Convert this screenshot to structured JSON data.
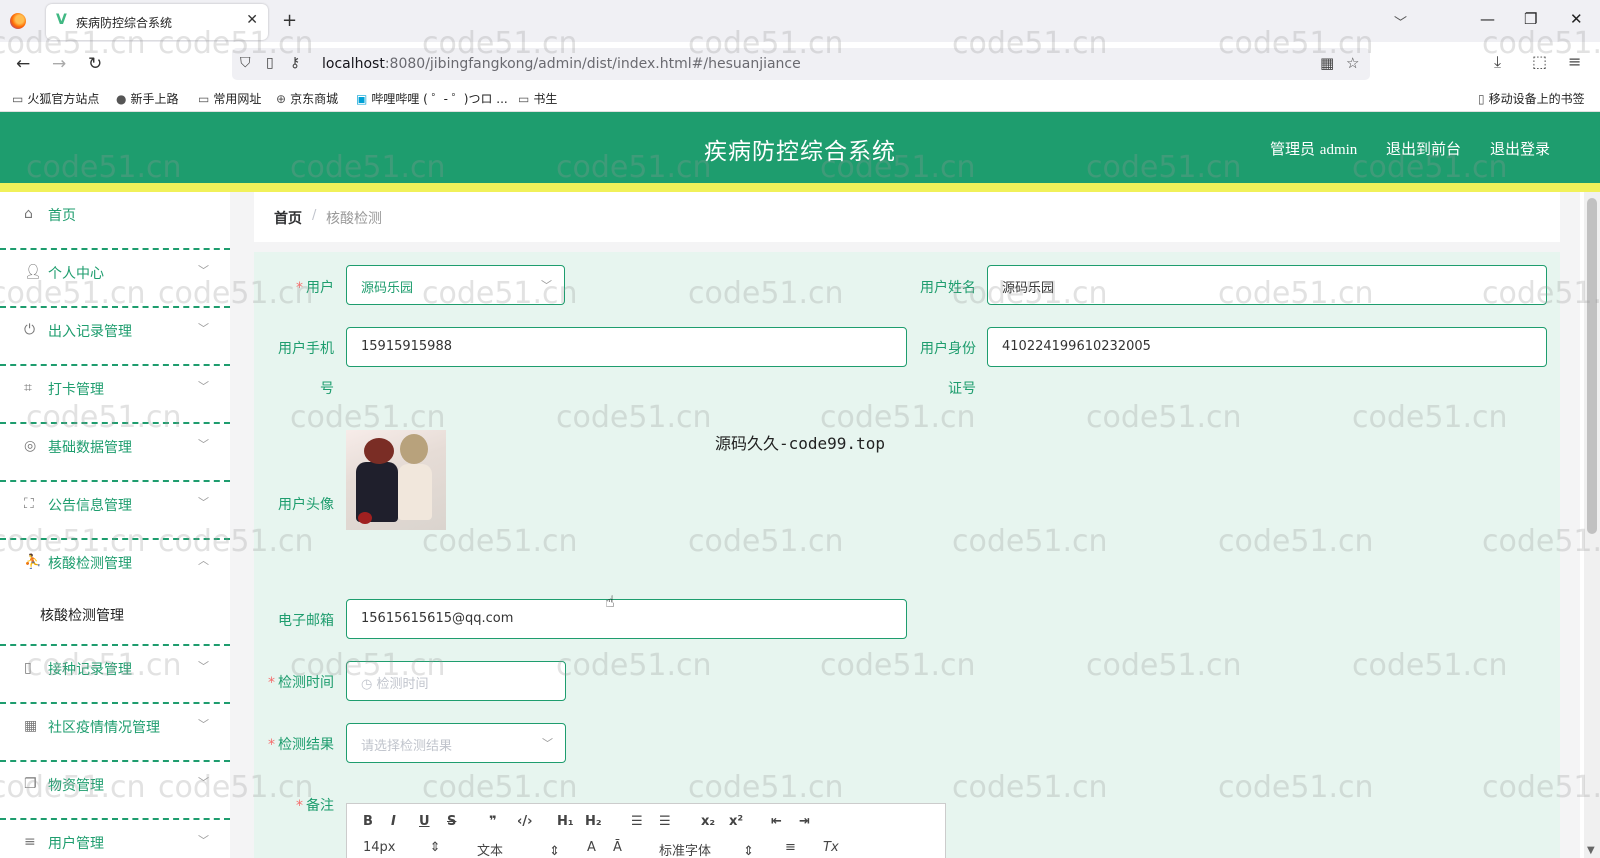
{
  "browser": {
    "tab_title": "疾病防控综合系统",
    "url_host": "localhost",
    "url_rest": ":8080/jibingfangkong/admin/dist/index.html#/hesuanjiance",
    "bookmarks": [
      "火狐官方站点",
      "新手上路",
      "常用网址",
      "京东商城",
      "哔哩哔哩 ( ゜- ゜)つロ ...",
      "书生"
    ],
    "mobile_bookmarks": "移动设备上的书签"
  },
  "header": {
    "title": "疾病防控综合系统",
    "user_prefix": "管理员",
    "user_name": "admin",
    "to_front": "退出到前台",
    "logout": "退出登录"
  },
  "sidebar": {
    "items": [
      {
        "label": "首页",
        "icon": "home-icon"
      },
      {
        "label": "个人中心",
        "icon": "user-icon"
      },
      {
        "label": "出入记录管理",
        "icon": "power-icon"
      },
      {
        "label": "打卡管理",
        "icon": "crop-icon"
      },
      {
        "label": "基础数据管理",
        "icon": "compass-icon"
      },
      {
        "label": "公告信息管理",
        "icon": "fullscreen-icon"
      },
      {
        "label": "核酸检测管理",
        "icon": "person-icon"
      },
      {
        "label": "接种记录管理",
        "icon": "phone-icon"
      },
      {
        "label": "社区疫情情况管理",
        "icon": "grid-icon"
      },
      {
        "label": "物资管理",
        "icon": "copy-icon"
      },
      {
        "label": "用户管理",
        "icon": "list-icon"
      }
    ],
    "sub_item": "核酸检测管理"
  },
  "breadcrumb": {
    "home": "首页",
    "sep": "/",
    "current": "核酸检测"
  },
  "form": {
    "user_label": "用户",
    "user_value": "源码乐园",
    "username_label": "用户姓名",
    "username_value": "源码乐园",
    "phone_label_1": "用户手机",
    "phone_label_2": "号",
    "phone_value": "15915915988",
    "idcard_label_1": "用户身份",
    "idcard_label_2": "证号",
    "idcard_value": "410224199610232005",
    "avatar_label": "用户头像",
    "email_label": "电子邮箱",
    "email_value": "15615615615@qq.com",
    "time_label": "检测时间",
    "time_placeholder": "检测时间",
    "result_label": "检测结果",
    "result_placeholder": "请选择检测结果",
    "remark_label": "备注"
  },
  "editor": {
    "font_size": "14px",
    "paragraph": "文本",
    "font_family": "标准字体"
  },
  "watermark": {
    "center": "源码久久-code99.top",
    "text": "code51.cn"
  },
  "colors": {
    "primary": "#1e9d6e",
    "accent_bar": "#f1f15a",
    "required": "#f56c6c"
  }
}
